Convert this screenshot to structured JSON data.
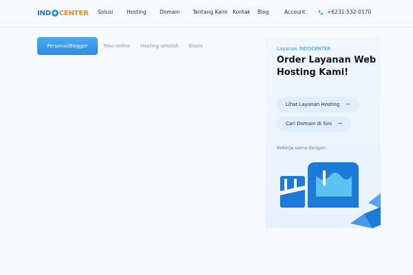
{
  "header": {
    "logo": {
      "part1": "IND",
      "part2": "CENTER"
    },
    "nav": [
      {
        "label": "Solusi"
      },
      {
        "label": "Hosting"
      },
      {
        "label": "Domain"
      },
      {
        "label": "Tentang Kami"
      },
      {
        "label": "Kontak"
      },
      {
        "label": "Blog"
      },
      {
        "label": "Account"
      }
    ],
    "phone": "+6231-532-0170"
  },
  "tabs": [
    {
      "label": "Personal/Blogger",
      "active": true
    },
    {
      "label": "Toko online",
      "active": false
    },
    {
      "label": "Hosting sekolah",
      "active": false
    },
    {
      "label": "Bisnis",
      "active": false
    }
  ],
  "panel": {
    "kicker": "Layanan INDOCENTER",
    "title": "Order Layanan Web Hosting Kami!",
    "buttons": [
      {
        "label": "Lihat Layanan Hosting"
      },
      {
        "label": "Cari Domain di Sini"
      }
    ],
    "partner_label": "Bekerja sama dengan:"
  },
  "colors": {
    "accent": "#2d8ae6",
    "logo_blue": "#1a73d9",
    "logo_orange": "#f28a1a",
    "background": "#f7fbff"
  },
  "icons": {
    "phone": "phone-icon",
    "arrow": "arrow-right-icon"
  }
}
